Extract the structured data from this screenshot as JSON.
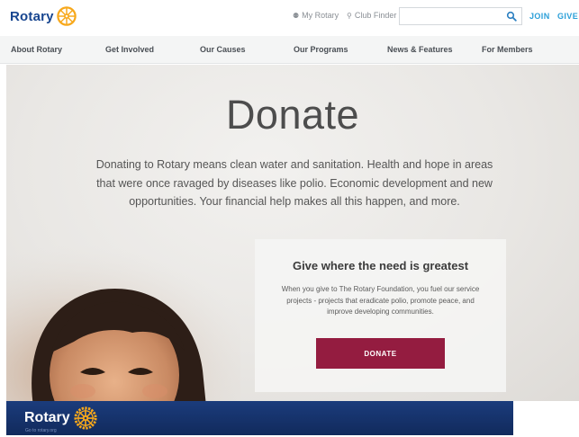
{
  "header": {
    "logo_text": "Rotary",
    "my_rotary": "My Rotary",
    "club_finder": "Club Finder",
    "search_placeholder": "",
    "join": "JOIN",
    "give": "GIVE"
  },
  "nav": {
    "items": [
      {
        "label": "About Rotary"
      },
      {
        "label": "Get Involved"
      },
      {
        "label": "Our Causes"
      },
      {
        "label": "Our Programs"
      },
      {
        "label": "News & Features"
      },
      {
        "label": "For Members"
      }
    ]
  },
  "hero": {
    "title": "Donate",
    "body": "Donating to Rotary means clean water and sanitation. Health and hope in areas that were once ravaged by diseases like polio. Economic development and new opportunities. Your financial help makes all this happen, and more."
  },
  "card": {
    "title": "Give where the need is greatest",
    "body": "When you give to The Rotary Foundation, you fuel our service projects - projects that eradicate polio, promote peace, and improve developing communities.",
    "button": "DONATE"
  },
  "footer_banner": {
    "logo_text": "Rotary",
    "small_text": "Go to rotary.org"
  },
  "colors": {
    "brand_blue": "#17458f",
    "link_blue": "#2a9fd8",
    "gold": "#f7a81b",
    "donate_red": "#941c40",
    "banner_navy": "#14306b"
  },
  "icons": {
    "my_rotary": "person-icon",
    "club_finder": "location-pin-icon",
    "search": "search-icon",
    "logo": "rotary-wheel-icon"
  }
}
